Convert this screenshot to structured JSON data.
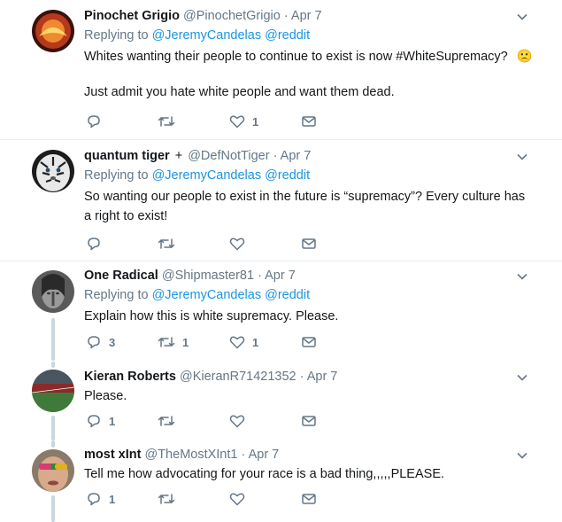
{
  "tweets": [
    {
      "name": "Pinochet Grigio",
      "handle": "@PinochetGrigio",
      "dot": "·",
      "time": "Apr 7",
      "replying_prefix": "Replying to",
      "replying_to": "@JeremyCandelas @reddit",
      "text1": "Whites wanting their people to continue to exist is now #WhiteSupremacy?",
      "emoji": "🙁",
      "text2": "Just admit you hate white people and want them dead.",
      "reply_count": "",
      "retweet_count": "",
      "like_count": "1"
    },
    {
      "name": "quantum tiger",
      "verified_glyph": "+",
      "handle": "@DefNotTiger",
      "dot": "·",
      "time": "Apr 7",
      "replying_prefix": "Replying to",
      "replying_to": "@JeremyCandelas @reddit",
      "text": "So wanting our people to exist in the future is “supremacy”? Every culture has a right to exist!",
      "reply_count": "",
      "retweet_count": "",
      "like_count": ""
    },
    {
      "name": "One Radical",
      "handle": "@Shipmaster81",
      "dot": "·",
      "time": "Apr 7",
      "replying_prefix": "Replying to",
      "replying_to": "@JeremyCandelas @reddit",
      "text": "Explain how this is white supremacy. Please.",
      "reply_count": "3",
      "retweet_count": "1",
      "like_count": "1"
    },
    {
      "name": "Kieran Roberts",
      "handle": "@KieranR71421352",
      "dot": "·",
      "time": "Apr 7",
      "text": "Please.",
      "reply_count": "1",
      "retweet_count": "",
      "like_count": ""
    },
    {
      "name": "most xInt",
      "handle": "@TheMostXInt1",
      "dot": "·",
      "time": "Apr 7",
      "text": "Tell me how advocating for your race is a bad thing,,,,,PLEASE.",
      "reply_count": "1",
      "retweet_count": "",
      "like_count": ""
    }
  ],
  "icons": {
    "reply": "reply-icon",
    "retweet": "retweet-icon",
    "like": "heart-icon",
    "message": "direct-message-icon",
    "more": "chevron-down-icon"
  },
  "colors": {
    "text": "#14171a",
    "muted": "#657786",
    "link": "#1b95e0",
    "divider": "#e6ecf0",
    "thread": "#ccd6dd"
  }
}
